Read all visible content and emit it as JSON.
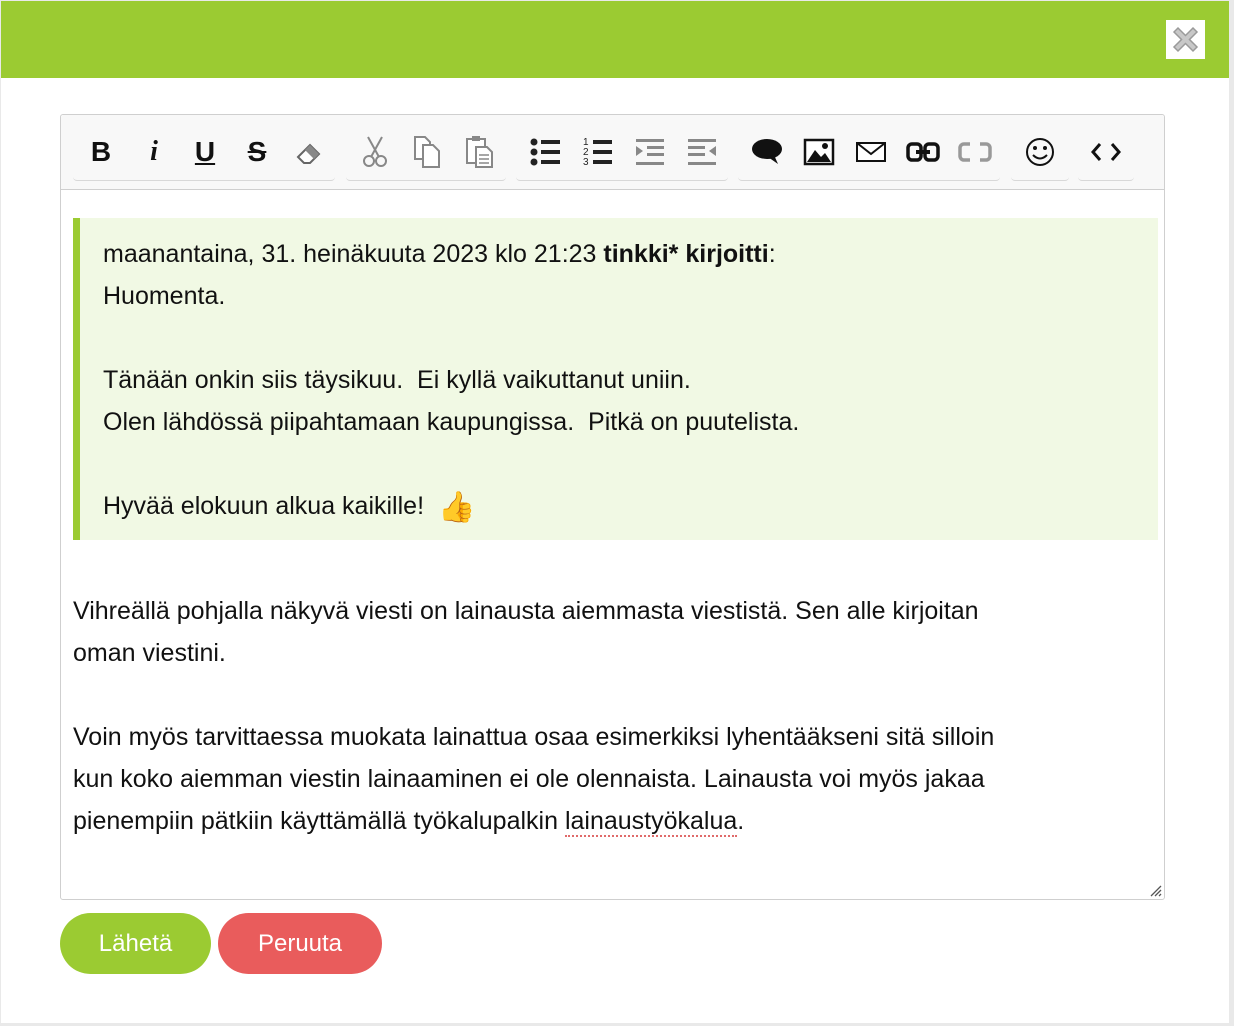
{
  "dialog": {
    "header_color": "#9bcb32",
    "close_icon": "close-icon"
  },
  "toolbar": {
    "bold": "B",
    "italic": "i",
    "underline": "U",
    "strikethrough": "S",
    "icons": [
      "bold-icon",
      "italic-icon",
      "underline-icon",
      "strikethrough-icon",
      "eraser-icon",
      "cut-icon",
      "copy-icon",
      "paste-icon",
      "bullet-list-icon",
      "numbered-list-icon",
      "indent-icon",
      "outdent-icon",
      "quote-bubble-icon",
      "image-icon",
      "email-icon",
      "link-icon",
      "unlink-icon",
      "smiley-icon",
      "source-code-icon"
    ]
  },
  "quote": {
    "date": "maanantaina, 31. heinäkuuta 2023 klo 21:23 ",
    "author": "tinkki* kirjoitti",
    "colon": ":",
    "line1": "Huomenta.",
    "line2": "Tänään onkin siis täysikuu.  Ei kyllä vaikuttanut uniin.",
    "line3": "Olen lähdössä piipahtamaan kaupungissa.  Pitkä on puutelista.",
    "line4": "Hyvää elokuun alkua kaikille!",
    "emoji": "👍"
  },
  "body": {
    "p1_line1": "Vihreällä pohjalla näkyvä viesti on lainausta aiemmasta viestistä. Sen alle kirjoitan",
    "p1_line2": "oman viestini.",
    "p2_line1": "Voin myös tarvittaessa muokata lainattua osaa esimerkiksi lyhentääkseni sitä silloin",
    "p2_line2": "kun koko aiemman viestin lainaaminen ei ole olennaista. Lainausta voi myös jakaa",
    "p2_line3_pre": "pienempiin pätkiin käyttämällä työkalupalkin ",
    "p2_line3_word": "lainaustyökalua",
    "p2_line3_post": "."
  },
  "buttons": {
    "send": "Lähetä",
    "cancel": "Peruuta",
    "send_color": "#9bcb32",
    "cancel_color": "#e95c5c"
  }
}
